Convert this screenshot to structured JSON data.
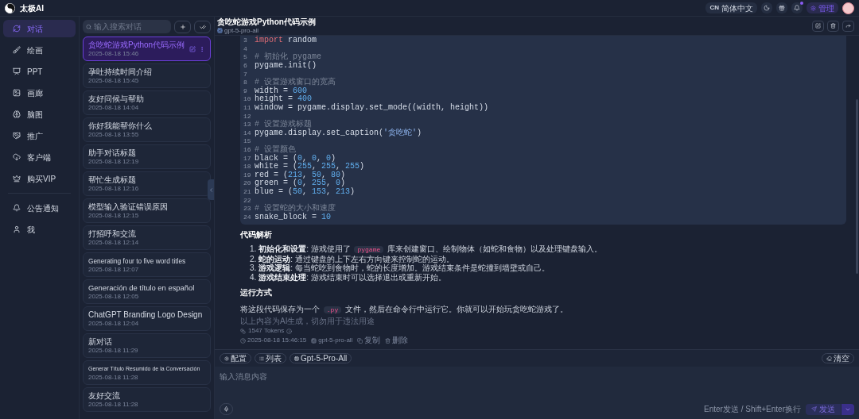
{
  "app": {
    "name": "太极AI"
  },
  "nav": {
    "items": [
      {
        "label": "对话",
        "selected": true
      },
      {
        "label": "绘画",
        "selected": false
      },
      {
        "label": "PPT",
        "selected": false
      },
      {
        "label": "画廊",
        "selected": false
      },
      {
        "label": "脑图",
        "selected": false
      },
      {
        "label": "推广",
        "selected": false
      },
      {
        "label": "客户端",
        "selected": false
      },
      {
        "label": "购买VIP",
        "selected": false
      }
    ],
    "bottom_items": [
      {
        "label": "公告通知",
        "selected": false
      },
      {
        "label": "我",
        "selected": false
      }
    ]
  },
  "conversations": {
    "search": {
      "placeholder": "输入搜索对话"
    },
    "items": [
      {
        "title": "贪吃蛇游戏Python代码示例",
        "time": "2025-08-18 15:46",
        "selected": true
      },
      {
        "title": "孕吐持续时间介绍",
        "time": "2025-08-18 15:45",
        "selected": false
      },
      {
        "title": "友好问候与帮助",
        "time": "2025-08-18 14:04",
        "selected": false
      },
      {
        "title": "你好我能帮你什么",
        "time": "2025-08-18 13:55",
        "selected": false
      },
      {
        "title": "助手对话标题",
        "time": "2025-08-18 12:19",
        "selected": false
      },
      {
        "title": "帮忙生成标题",
        "time": "2025-08-18 12:16",
        "selected": false
      },
      {
        "title": "模型输入验证错误原因",
        "time": "2025-08-18 12:15",
        "selected": false
      },
      {
        "title": "打招呼和交流",
        "time": "2025-08-18 12:14",
        "selected": false
      },
      {
        "title": "Generating four to five word titles",
        "time": "2025-08-18 12:07",
        "selected": false
      },
      {
        "title": "Generación de título en español",
        "time": "2025-08-18 12:05",
        "selected": false
      },
      {
        "title": "ChatGPT Branding Logo Design",
        "time": "2025-08-18 12:04",
        "selected": false
      },
      {
        "title": "新对话",
        "time": "2025-08-18 11:29",
        "selected": false
      },
      {
        "title": "Generar Título Resumido de la Conversación",
        "time": "2025-08-18 11:28",
        "selected": false
      },
      {
        "title": "友好交流",
        "time": "2025-08-18 11:28",
        "selected": false
      }
    ]
  },
  "topbar": {
    "language": {
      "code": "CN",
      "label": "简体中文"
    },
    "notification_dot": true,
    "admin": "管理"
  },
  "chat": {
    "title": "贪吃蛇游戏Python代码示例",
    "model": "gpt-5-pro-all",
    "code": [
      {
        "n": "3",
        "segments": [
          {
            "kind": "kw",
            "text": "import"
          },
          {
            "kind": "plain",
            "text": " random"
          }
        ]
      },
      {
        "n": "4"
      },
      {
        "n": "5",
        "segments": [
          {
            "kind": "comment",
            "text": "# 初始化 pygame"
          }
        ]
      },
      {
        "n": "6",
        "segments": [
          {
            "kind": "plain",
            "text": "pygame.init()"
          }
        ]
      },
      {
        "n": "7"
      },
      {
        "n": "8",
        "segments": [
          {
            "kind": "comment",
            "text": "# 设置游戏窗口的宽高"
          }
        ]
      },
      {
        "n": "9",
        "segments": [
          {
            "kind": "plain",
            "text": "width = "
          },
          {
            "kind": "num",
            "text": "600"
          }
        ]
      },
      {
        "n": "10",
        "segments": [
          {
            "kind": "plain",
            "text": "height = "
          },
          {
            "kind": "num",
            "text": "400"
          }
        ]
      },
      {
        "n": "11",
        "segments": [
          {
            "kind": "plain",
            "text": "window = pygame.display.set_mode((width, height))"
          }
        ]
      },
      {
        "n": "12"
      },
      {
        "n": "13",
        "segments": [
          {
            "kind": "comment",
            "text": "# 设置游戏标题"
          }
        ]
      },
      {
        "n": "14",
        "segments": [
          {
            "kind": "plain",
            "text": "pygame.display.set_caption("
          },
          {
            "kind": "str",
            "text": "'贪吃蛇'"
          },
          {
            "kind": "plain",
            "text": ")"
          }
        ]
      },
      {
        "n": "15"
      },
      {
        "n": "16",
        "segments": [
          {
            "kind": "comment",
            "text": "# 设置颜色"
          }
        ]
      },
      {
        "n": "17",
        "segments": [
          {
            "kind": "plain",
            "text": "black = ("
          },
          {
            "kind": "num",
            "text": "0"
          },
          {
            "kind": "plain",
            "text": ", "
          },
          {
            "kind": "num",
            "text": "0"
          },
          {
            "kind": "plain",
            "text": ", "
          },
          {
            "kind": "num",
            "text": "0"
          },
          {
            "kind": "plain",
            "text": ")"
          }
        ]
      },
      {
        "n": "18",
        "segments": [
          {
            "kind": "plain",
            "text": "white = ("
          },
          {
            "kind": "num",
            "text": "255"
          },
          {
            "kind": "plain",
            "text": ", "
          },
          {
            "kind": "num",
            "text": "255"
          },
          {
            "kind": "plain",
            "text": ", "
          },
          {
            "kind": "num",
            "text": "255"
          },
          {
            "kind": "plain",
            "text": ")"
          }
        ]
      },
      {
        "n": "19",
        "segments": [
          {
            "kind": "plain",
            "text": "red = ("
          },
          {
            "kind": "num",
            "text": "213"
          },
          {
            "kind": "plain",
            "text": ", "
          },
          {
            "kind": "num",
            "text": "50"
          },
          {
            "kind": "plain",
            "text": ", "
          },
          {
            "kind": "num",
            "text": "80"
          },
          {
            "kind": "plain",
            "text": ")"
          }
        ]
      },
      {
        "n": "20",
        "segments": [
          {
            "kind": "plain",
            "text": "green = ("
          },
          {
            "kind": "num",
            "text": "0"
          },
          {
            "kind": "plain",
            "text": ", "
          },
          {
            "kind": "num",
            "text": "255"
          },
          {
            "kind": "plain",
            "text": ", "
          },
          {
            "kind": "num",
            "text": "0"
          },
          {
            "kind": "plain",
            "text": ")"
          }
        ]
      },
      {
        "n": "21",
        "segments": [
          {
            "kind": "plain",
            "text": "blue = ("
          },
          {
            "kind": "num",
            "text": "50"
          },
          {
            "kind": "plain",
            "text": ", "
          },
          {
            "kind": "num",
            "text": "153"
          },
          {
            "kind": "plain",
            "text": ", "
          },
          {
            "kind": "num",
            "text": "213"
          },
          {
            "kind": "plain",
            "text": ")"
          }
        ]
      },
      {
        "n": "22"
      },
      {
        "n": "23",
        "segments": [
          {
            "kind": "comment",
            "text": "# 设置蛇的大小和速度"
          }
        ]
      },
      {
        "n": "24",
        "segments": [
          {
            "kind": "plain",
            "text": "snake_block = "
          },
          {
            "kind": "num",
            "text": "10"
          }
        ]
      }
    ],
    "analysis_heading": "代码解析",
    "analysis": [
      {
        "marker": "1.",
        "segments": [
          {
            "kind": "bold",
            "text": "初始化和设置"
          },
          {
            "kind": "text",
            "text": ": 游戏使用了 "
          },
          {
            "kind": "code",
            "text": "pygame"
          },
          {
            "kind": "text",
            "text": " 库来创建窗口、绘制物体（如蛇和食物）以及处理键盘输入。"
          }
        ]
      },
      {
        "marker": "2.",
        "segments": [
          {
            "kind": "bold",
            "text": "蛇的运动"
          },
          {
            "kind": "text",
            "text": ": 通过键盘的上下左右方向键来控制蛇的运动。"
          }
        ]
      },
      {
        "marker": "3.",
        "segments": [
          {
            "kind": "bold",
            "text": "游戏逻辑"
          },
          {
            "kind": "text",
            "text": ": 每当蛇吃到食物时，蛇的长度增加。游戏结束条件是蛇撞到墙壁或自己。"
          }
        ]
      },
      {
        "marker": "4.",
        "segments": [
          {
            "kind": "bold",
            "text": "游戏结束处理"
          },
          {
            "kind": "text",
            "text": ": 游戏结束时可以选择退出或重新开始。"
          }
        ]
      }
    ],
    "run_heading": "运行方式",
    "run_text": [
      {
        "kind": "text",
        "text": "将这段代码保存为一个 "
      },
      {
        "kind": "code",
        "text": ".py"
      },
      {
        "kind": "text",
        "text": " 文件，然后在命令行中运行它。你就可以开始玩贪吃蛇游戏了。"
      }
    ],
    "disclaimer": "以上内容为AI生成，切勿用于违法用途",
    "tokens": "1547 Tokens",
    "meta": {
      "time": "2025-08-18 15:46:15",
      "model": "gpt-5-pro-all",
      "copy": "复制",
      "delete": "删除"
    }
  },
  "composer": {
    "chips": [
      {
        "label": "配置"
      },
      {
        "label": "列表"
      },
      {
        "label": "Gpt-5-Pro-All"
      }
    ],
    "clear": "清空",
    "placeholder": "输入消息内容",
    "hint": "Enter发送 / Shift+Enter换行",
    "send": "发送"
  }
}
